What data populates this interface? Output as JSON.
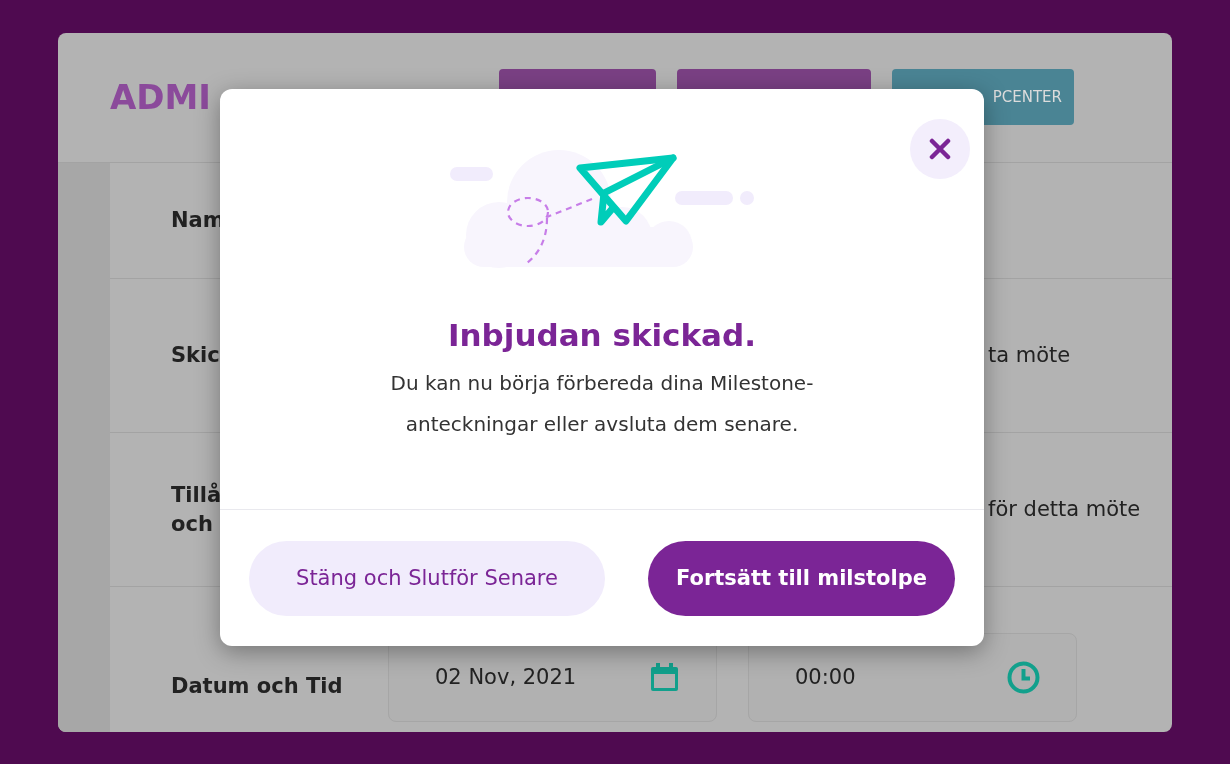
{
  "header": {
    "title": "ADMI",
    "buttons": [
      {
        "kind": "primary"
      },
      {
        "kind": "primary"
      },
      {
        "kind": "help",
        "label": "PCENTER"
      }
    ]
  },
  "form": {
    "rows": [
      {
        "label_lines": [
          "Nam"
        ]
      },
      {
        "label_lines": [
          "Skic"
        ],
        "value": "ta möte"
      },
      {
        "label_lines": [
          "Tillå",
          "och"
        ],
        "value": "för detta möte"
      },
      {
        "label_lines": [
          "Datum och Tid"
        ],
        "date_field": {
          "value": "02 Nov, 2021"
        },
        "time_field": {
          "value": "00:00"
        }
      }
    ]
  },
  "modal": {
    "title": "Inbjudan skickad.",
    "message": "Du kan nu börja förbereda dina Milestone-anteckningar eller avsluta dem senare.",
    "buttons": [
      {
        "kind": "secondary",
        "label": "Stäng och Slutför Senare"
      },
      {
        "kind": "primary",
        "label": "Fortsätt till milstolpe"
      }
    ]
  }
}
